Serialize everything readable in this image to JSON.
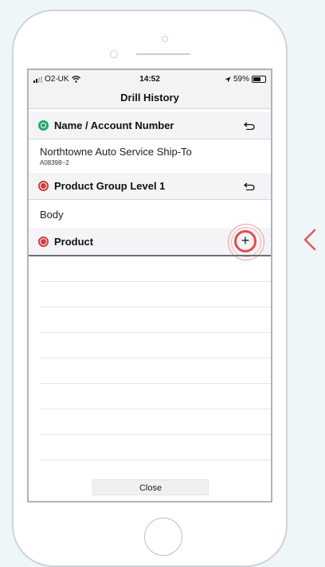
{
  "status_bar": {
    "carrier": "O2-UK",
    "time": "14:52",
    "battery_percent": "59%",
    "battery_level": 0.59
  },
  "nav_bar": {
    "title": "Drill History"
  },
  "sections": [
    {
      "title": "Name / Account Number",
      "dot_color": "#22a86b",
      "action_icon": "undo-icon",
      "value": "Northtowne Auto Service Ship-To",
      "sub_value": "A08398~2"
    },
    {
      "title": "Product Group Level 1",
      "dot_color": "#d63a3a",
      "action_icon": "undo-icon",
      "value": "Body"
    },
    {
      "title": "Product",
      "dot_color": "#d63a3a",
      "action_icon": "plus-icon",
      "action_label": "+"
    }
  ],
  "close_button": {
    "label": "Close"
  },
  "colors": {
    "highlight_ring": "#e34d4d",
    "background": "#eef6fa",
    "back_chevron": "#e05a5a"
  }
}
